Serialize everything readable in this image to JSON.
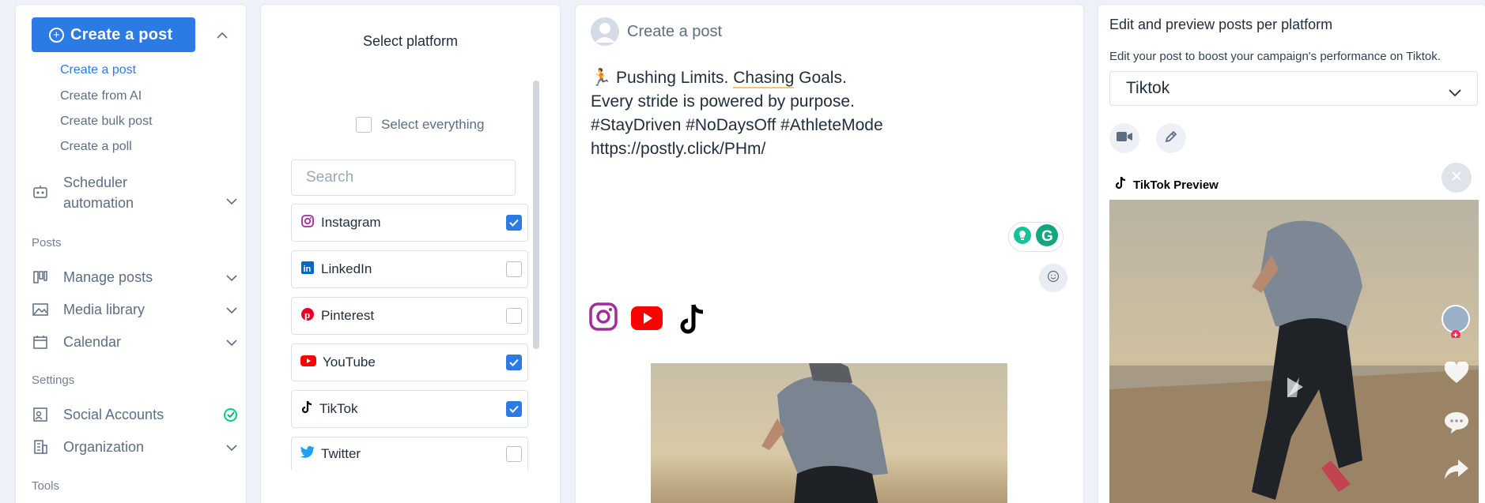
{
  "sidebar": {
    "create_button": "Create a post",
    "sub_links": [
      "Create a post",
      "Create from AI",
      "Create bulk post",
      "Create a poll"
    ],
    "scheduler": [
      "Scheduler",
      "automation"
    ],
    "section_posts": "Posts",
    "manage_posts": "Manage posts",
    "media_library": "Media library",
    "calendar": "Calendar",
    "section_settings": "Settings",
    "social_accounts": "Social Accounts",
    "organization": "Organization",
    "section_tools": "Tools"
  },
  "platforms": {
    "title": "Select platform",
    "select_all": "Select everything",
    "search_placeholder": "Search",
    "items": [
      {
        "name": "Instagram",
        "checked": true
      },
      {
        "name": "LinkedIn",
        "checked": false
      },
      {
        "name": "Pinterest",
        "checked": false
      },
      {
        "name": "YouTube",
        "checked": true
      },
      {
        "name": "TikTok",
        "checked": true
      },
      {
        "name": "Twitter",
        "checked": false
      }
    ]
  },
  "composer": {
    "title": "Create a post",
    "line1_pre": "🏃 Pushing Limits. ",
    "line1_underlined": "Chasing",
    "line1_post": " Goals.",
    "line2": "Every stride is powered by purpose.",
    "line3": "#StayDriven #NoDaysOff #AthleteMode",
    "line4": "https://postly.click/PHm/",
    "selected_platform_icons": [
      "instagram-icon",
      "youtube-icon",
      "tiktok-icon"
    ]
  },
  "preview": {
    "title": "Edit and preview posts per platform",
    "subtitle": "Edit your post to boost your campaign's performance on Tiktok.",
    "platform_select": "Tiktok",
    "tiktok_header": "TikTok Preview"
  },
  "colors": {
    "primary": "#2c7be5",
    "success": "#00d27a",
    "instagram": "#833ab4",
    "youtube": "#ff0000",
    "linkedin": "#0a66c2",
    "pinterest": "#e60023",
    "twitter": "#1da1f2"
  }
}
